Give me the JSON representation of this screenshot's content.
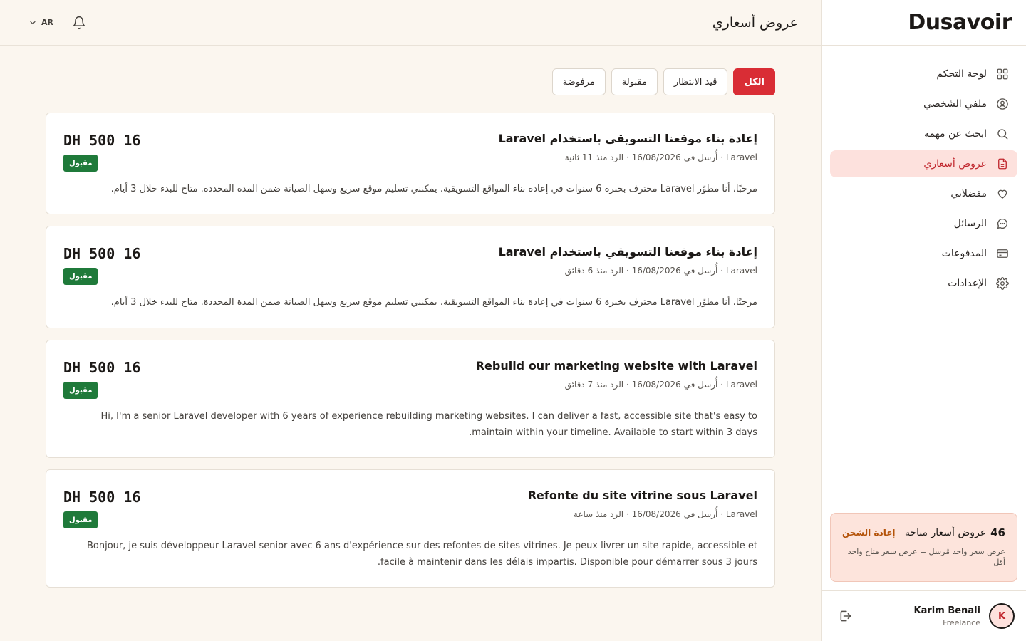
{
  "brand": {
    "logo_text": "Dusavoir"
  },
  "sidebar": {
    "items": [
      {
        "label": "لوحة التحكم",
        "icon": "grid-icon"
      },
      {
        "label": "ملفي الشخصي",
        "icon": "user-circle-icon"
      },
      {
        "label": "ابحث عن مهمة",
        "icon": "search-icon"
      },
      {
        "label": "عروض أسعاري",
        "icon": "document-icon",
        "active": true
      },
      {
        "label": "مفضلاتي",
        "icon": "heart-icon"
      },
      {
        "label": "الرسائل",
        "icon": "chat-icon"
      },
      {
        "label": "المدفوعات",
        "icon": "credit-card-icon"
      },
      {
        "label": "الإعدادات",
        "icon": "gear-icon"
      }
    ],
    "credits": {
      "count": "46",
      "label": "عروض أسعار متاحة",
      "recharge_label": "إعادة الشحن",
      "note": "عرض سعر واحد مُرسل = عرض سعر متاح واحد أقل"
    },
    "user": {
      "name": "Karim Benali",
      "role": "Freelance",
      "initial": "K"
    }
  },
  "header": {
    "title": "عروض أسعاري",
    "language": "AR"
  },
  "filters": [
    {
      "label": "الكل",
      "active": true
    },
    {
      "label": "قيد الانتظار"
    },
    {
      "label": "مقبولة"
    },
    {
      "label": "مرفوضة"
    }
  ],
  "quotes": [
    {
      "title": "إعادة بناء موقعنا التسويقي باستخدام Laravel",
      "meta": "Laravel · أُرسل في 16/08/2026 · الرد منذ 11 ثانية",
      "body": "مرحبًا، أنا مطوّر Laravel محترف بخبرة 6 سنوات في إعادة بناء المواقع التسويقية. يمكنني تسليم موقع سريع وسهل الصيانة ضمن المدة المحددة. متاح للبدء خلال 3 أيام.",
      "amount": "DH 500 16",
      "status": "مقبول",
      "dir": "rtl"
    },
    {
      "title": "إعادة بناء موقعنا التسويقي باستخدام Laravel",
      "meta": "Laravel · أُرسل في 16/08/2026 · الرد منذ 6 دقائق",
      "body": "مرحبًا، أنا مطوّر Laravel محترف بخبرة 6 سنوات في إعادة بناء المواقع التسويقية. يمكنني تسليم موقع سريع وسهل الصيانة ضمن المدة المحددة. متاح للبدء خلال 3 أيام.",
      "amount": "DH 500 16",
      "status": "مقبول",
      "dir": "rtl"
    },
    {
      "title": "Rebuild our marketing website with Laravel",
      "meta": "Laravel · أُرسل في 16/08/2026 · الرد منذ 7 دقائق",
      "body": "Hi, I'm a senior Laravel developer with 6 years of experience rebuilding marketing websites. I can deliver a fast, accessible site that's easy to maintain within your timeline. Available to start within 3 days.",
      "amount": "DH 500 16",
      "status": "مقبول",
      "dir": "rtl"
    },
    {
      "title": "Refonte du site vitrine sous Laravel",
      "meta": "Laravel · أُرسل في 16/08/2026 · الرد منذ ساعة",
      "body": "Bonjour, je suis développeur Laravel senior avec 6 ans d'expérience sur des refontes de sites vitrines. Je peux livrer un site rapide, accessible et facile à maintenir dans les délais impartis. Disponible pour démarrer sous 3 jours.",
      "amount": "DH 500 16",
      "status": "مقبول",
      "dir": "rtl"
    }
  ],
  "colors": {
    "accent": "#d92d35",
    "accepted": "#1f7a3a",
    "active_nav_bg": "#fde1dd",
    "background": "#fbf6ef"
  }
}
